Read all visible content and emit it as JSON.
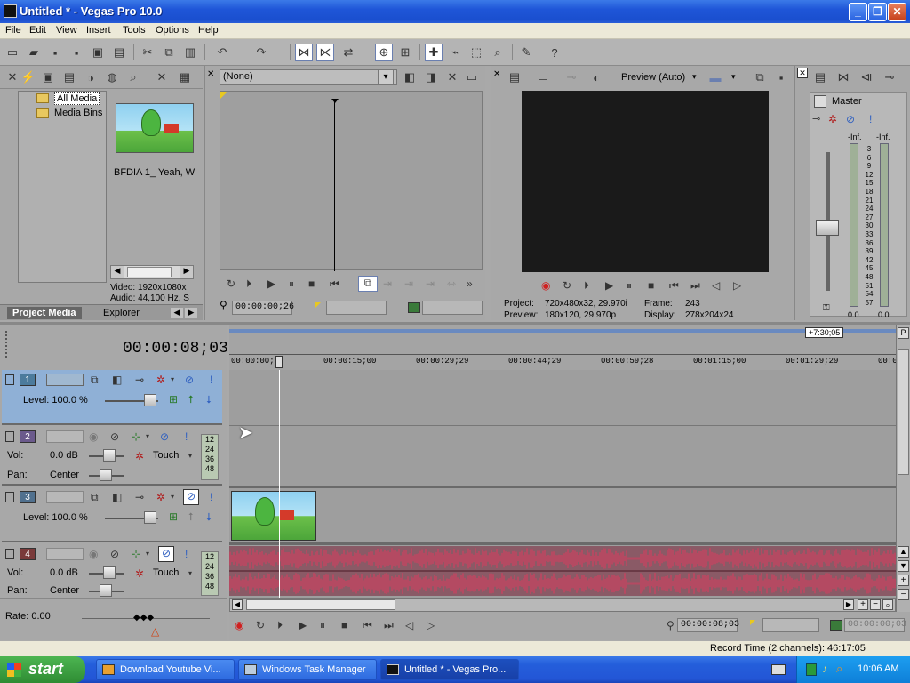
{
  "window": {
    "title": "Untitled * - Vegas Pro 10.0",
    "min": "_",
    "max": "❐",
    "close": "✕"
  },
  "menu": [
    "File",
    "Edit",
    "View",
    "Insert",
    "Tools",
    "Options",
    "Help"
  ],
  "media": {
    "tree": [
      "All Media",
      "Media Bins"
    ],
    "clip_name": "BFDIA 1_ Yeah, W",
    "info_video": "Video: 1920x1080x",
    "info_audio": "Audio: 44,100 Hz, S",
    "tabs": [
      "Project Media",
      "Explorer"
    ]
  },
  "trimmer": {
    "source_select": "(None)",
    "timecode": "00:00:00;26"
  },
  "preview": {
    "mode": "Preview (Auto)",
    "project_label": "Project:",
    "project_value": "720x480x32, 29.970i",
    "preview_label": "Preview:",
    "preview_value": "180x120, 29.970p",
    "frame_label": "Frame:",
    "frame_value": "243",
    "display_label": "Display:",
    "display_value": "278x204x24"
  },
  "master": {
    "label": "Master",
    "peak_left": "-Inf.",
    "peak_right": "-Inf.",
    "scale": [
      "3",
      "6",
      "9",
      "12",
      "15",
      "18",
      "21",
      "24",
      "27",
      "30",
      "33",
      "36",
      "39",
      "42",
      "45",
      "48",
      "51",
      "54",
      "57"
    ],
    "level_left": "0.0",
    "level_right": "0.0"
  },
  "timeline": {
    "current_time": "00:00:08;03",
    "end_marker": "+7:30;05",
    "ruler": [
      "00:00:00;00",
      "00:00:15;00",
      "00:00:29;29",
      "00:00:44;29",
      "00:00:59;28",
      "00:01:15;00",
      "00:01:29;29",
      "00:0"
    ],
    "rate_label": "Rate: 0.00",
    "transport_time": "00:00:08;03",
    "end_time": "00:00:00;03",
    "status": "Record Time (2 channels): 46:17:05"
  },
  "tracks": [
    {
      "num": "1",
      "type": "video",
      "line1": "Level: 100.0 %"
    },
    {
      "num": "2",
      "type": "audio",
      "vol_label": "Vol:",
      "vol_value": "0.0 dB",
      "pan_label": "Pan:",
      "pan_value": "Center",
      "touch": "Touch",
      "meter": [
        "12",
        "24",
        "36",
        "48"
      ]
    },
    {
      "num": "3",
      "type": "video",
      "line1": "Level: 100.0 %"
    },
    {
      "num": "4",
      "type": "audio",
      "vol_label": "Vol:",
      "vol_value": "0.0 dB",
      "pan_label": "Pan:",
      "pan_value": "Center",
      "touch": "Touch",
      "meter": [
        "12",
        "24",
        "36",
        "48"
      ]
    }
  ],
  "taskbar": {
    "start": "start",
    "tasks": [
      "Download Youtube Vi...",
      "Windows Task Manager",
      "Untitled * - Vegas Pro..."
    ],
    "clock": "10:06 AM"
  },
  "colors": {
    "track1": "#4c7b9c",
    "track2": "#6b5a8c",
    "track3": "#50708e",
    "track4": "#7a3a3a",
    "waveform": "#9c4a5c",
    "selected_header": "#8fb0d6"
  }
}
